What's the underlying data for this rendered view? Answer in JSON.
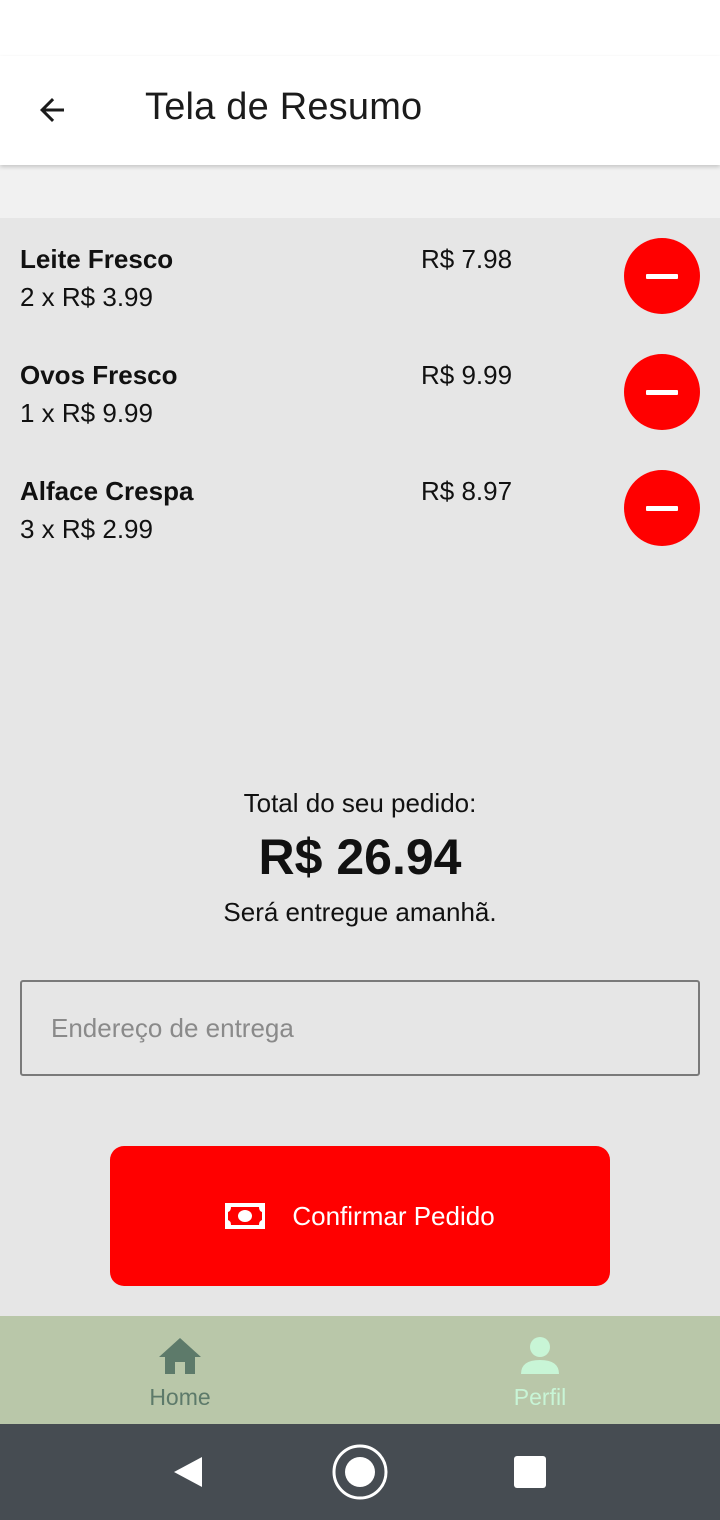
{
  "app_bar": {
    "title": "Tela de Resumo",
    "back_icon": "arrow-left-icon"
  },
  "items": [
    {
      "name": "Leite Fresco",
      "qty": "2 x R$ 3.99",
      "price": "R$ 7.98"
    },
    {
      "name": "Ovos Fresco",
      "qty": "1 x R$ 9.99",
      "price": "R$ 9.99"
    },
    {
      "name": "Alface Crespa",
      "qty": "3 x R$ 2.99",
      "price": "R$ 8.97"
    }
  ],
  "summary": {
    "total_label": "Total do seu pedido:",
    "total_value": "R$ 26.94",
    "delivery_note": "Será entregue amanhã."
  },
  "address": {
    "placeholder": "Endereço de entrega",
    "value": ""
  },
  "confirm": {
    "label": "Confirmar Pedido",
    "icon": "cash-icon"
  },
  "bottom_nav": [
    {
      "label": "Home",
      "icon": "home-icon",
      "active": false
    },
    {
      "label": "Perfil",
      "icon": "person-icon",
      "active": true
    }
  ],
  "colors": {
    "accent": "#ff0000",
    "background": "#e6e6e6",
    "bottom_nav": "#b9c7a9",
    "nav_active": "#c8f5d6",
    "nav_inactive": "#5d7a6a",
    "system_nav": "#464c52"
  }
}
